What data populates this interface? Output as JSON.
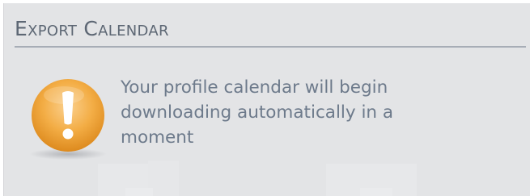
{
  "dialog": {
    "title": "Export Calendar",
    "message": "Your profile calendar will begin downloading automatically in a moment",
    "icon": "exclamation-warning-icon",
    "colors": {
      "background": "#e3e4e6",
      "title": "#5d6774",
      "message": "#6d7a8b",
      "icon_fill": "#f3ad45"
    }
  }
}
